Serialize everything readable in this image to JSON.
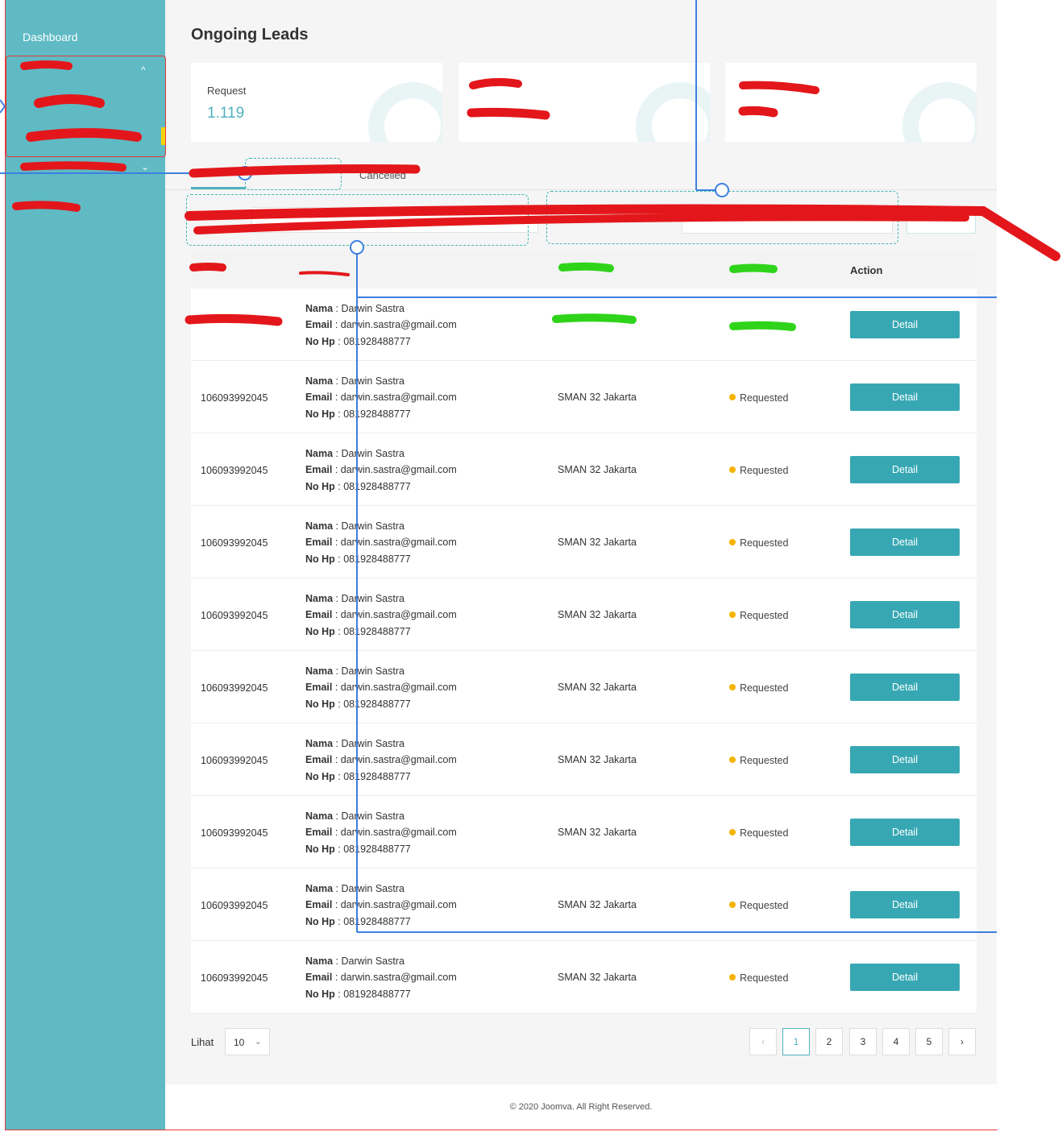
{
  "sidebar": {
    "dashboard": "Dashboard",
    "chevron_up": "^",
    "chevron_down": "⌄"
  },
  "header": {
    "title": "Ongoing Leads"
  },
  "cards": [
    {
      "label": "Request",
      "value": "1.119"
    },
    {
      "label": "",
      "value": ""
    },
    {
      "label": "",
      "value": ""
    }
  ],
  "tabs": {
    "cancelled": "Cancelled"
  },
  "table": {
    "headers": {
      "id": "",
      "bio": "",
      "school": "",
      "status": "",
      "action": "Action"
    },
    "labels": {
      "nama": "Nama",
      "email": "Email",
      "nohp": "No Hp",
      "sep": " : "
    },
    "rows": [
      {
        "id": "",
        "nama": "Darwin Sastra",
        "email": "darwin.sastra@gmail.com",
        "nohp": "081928488777",
        "school": "",
        "status": "",
        "action": "Detail"
      },
      {
        "id": "106093992045",
        "nama": "Darwin Sastra",
        "email": "darwin.sastra@gmail.com",
        "nohp": "081928488777",
        "school": "SMAN 32 Jakarta",
        "status": "Requested",
        "action": "Detail"
      },
      {
        "id": "106093992045",
        "nama": "Darwin Sastra",
        "email": "darwin.sastra@gmail.com",
        "nohp": "081928488777",
        "school": "SMAN 32 Jakarta",
        "status": "Requested",
        "action": "Detail"
      },
      {
        "id": "106093992045",
        "nama": "Darwin Sastra",
        "email": "darwin.sastra@gmail.com",
        "nohp": "081928488777",
        "school": "SMAN 32 Jakarta",
        "status": "Requested",
        "action": "Detail"
      },
      {
        "id": "106093992045",
        "nama": "Darwin Sastra",
        "email": "darwin.sastra@gmail.com",
        "nohp": "081928488777",
        "school": "SMAN 32 Jakarta",
        "status": "Requested",
        "action": "Detail"
      },
      {
        "id": "106093992045",
        "nama": "Darwin Sastra",
        "email": "darwin.sastra@gmail.com",
        "nohp": "081928488777",
        "school": "SMAN 32 Jakarta",
        "status": "Requested",
        "action": "Detail"
      },
      {
        "id": "106093992045",
        "nama": "Darwin Sastra",
        "email": "darwin.sastra@gmail.com",
        "nohp": "081928488777",
        "school": "SMAN 32 Jakarta",
        "status": "Requested",
        "action": "Detail"
      },
      {
        "id": "106093992045",
        "nama": "Darwin Sastra",
        "email": "darwin.sastra@gmail.com",
        "nohp": "081928488777",
        "school": "SMAN 32 Jakarta",
        "status": "Requested",
        "action": "Detail"
      },
      {
        "id": "106093992045",
        "nama": "Darwin Sastra",
        "email": "darwin.sastra@gmail.com",
        "nohp": "081928488777",
        "school": "SMAN 32 Jakarta",
        "status": "Requested",
        "action": "Detail"
      },
      {
        "id": "106093992045",
        "nama": "Darwin Sastra",
        "email": "darwin.sastra@gmail.com",
        "nohp": "081928488777",
        "school": "SMAN 32 Jakarta",
        "status": "Requested",
        "action": "Detail"
      }
    ]
  },
  "pagination": {
    "lihat_label": "Lihat",
    "per_page": "10",
    "prev": "‹",
    "next": "›",
    "pages": [
      "1",
      "2",
      "3",
      "4",
      "5"
    ],
    "active_page": "1"
  },
  "footer": {
    "text": "© 2020 Joomva. All Right Reserved."
  },
  "colors": {
    "sidebar": "#5fbac4",
    "accent": "#37a8b3",
    "status_dot": "#f5b300",
    "annotation_red": "#e53935",
    "annotation_blue": "#3d7fe0",
    "annotation_green": "#2fd41a"
  }
}
